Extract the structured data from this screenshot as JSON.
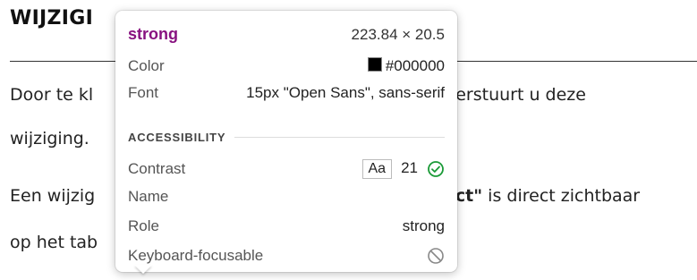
{
  "page": {
    "heading": "WIJZIGI",
    "para1": "Door te kl",
    "para1_after": "verstuurt u deze",
    "para2": "wijziging.",
    "para3_start": "Een wijzig",
    "para3_bold": "ect\"",
    "para3_end": " is direct zichtbaar",
    "para4": "op het tab"
  },
  "tooltip": {
    "tag": "strong",
    "dimensions": "223.84 × 20.5",
    "color_label": "Color",
    "color_value": "#000000",
    "font_label": "Font",
    "font_value": "15px \"Open Sans\", sans-serif",
    "section_title": "ACCESSIBILITY",
    "contrast_label": "Contrast",
    "contrast_sample": "Aa",
    "contrast_value": "21",
    "name_label": "Name",
    "name_value": "",
    "role_label": "Role",
    "role_value": "strong",
    "keyboard_label": "Keyboard-focusable",
    "icons": {
      "contrast_status": "check-circle-icon",
      "keyboard_status": "not-allowed-icon"
    },
    "colors": {
      "tag": "#881280",
      "check": "#1a9a37",
      "swatch": "#000000"
    }
  }
}
